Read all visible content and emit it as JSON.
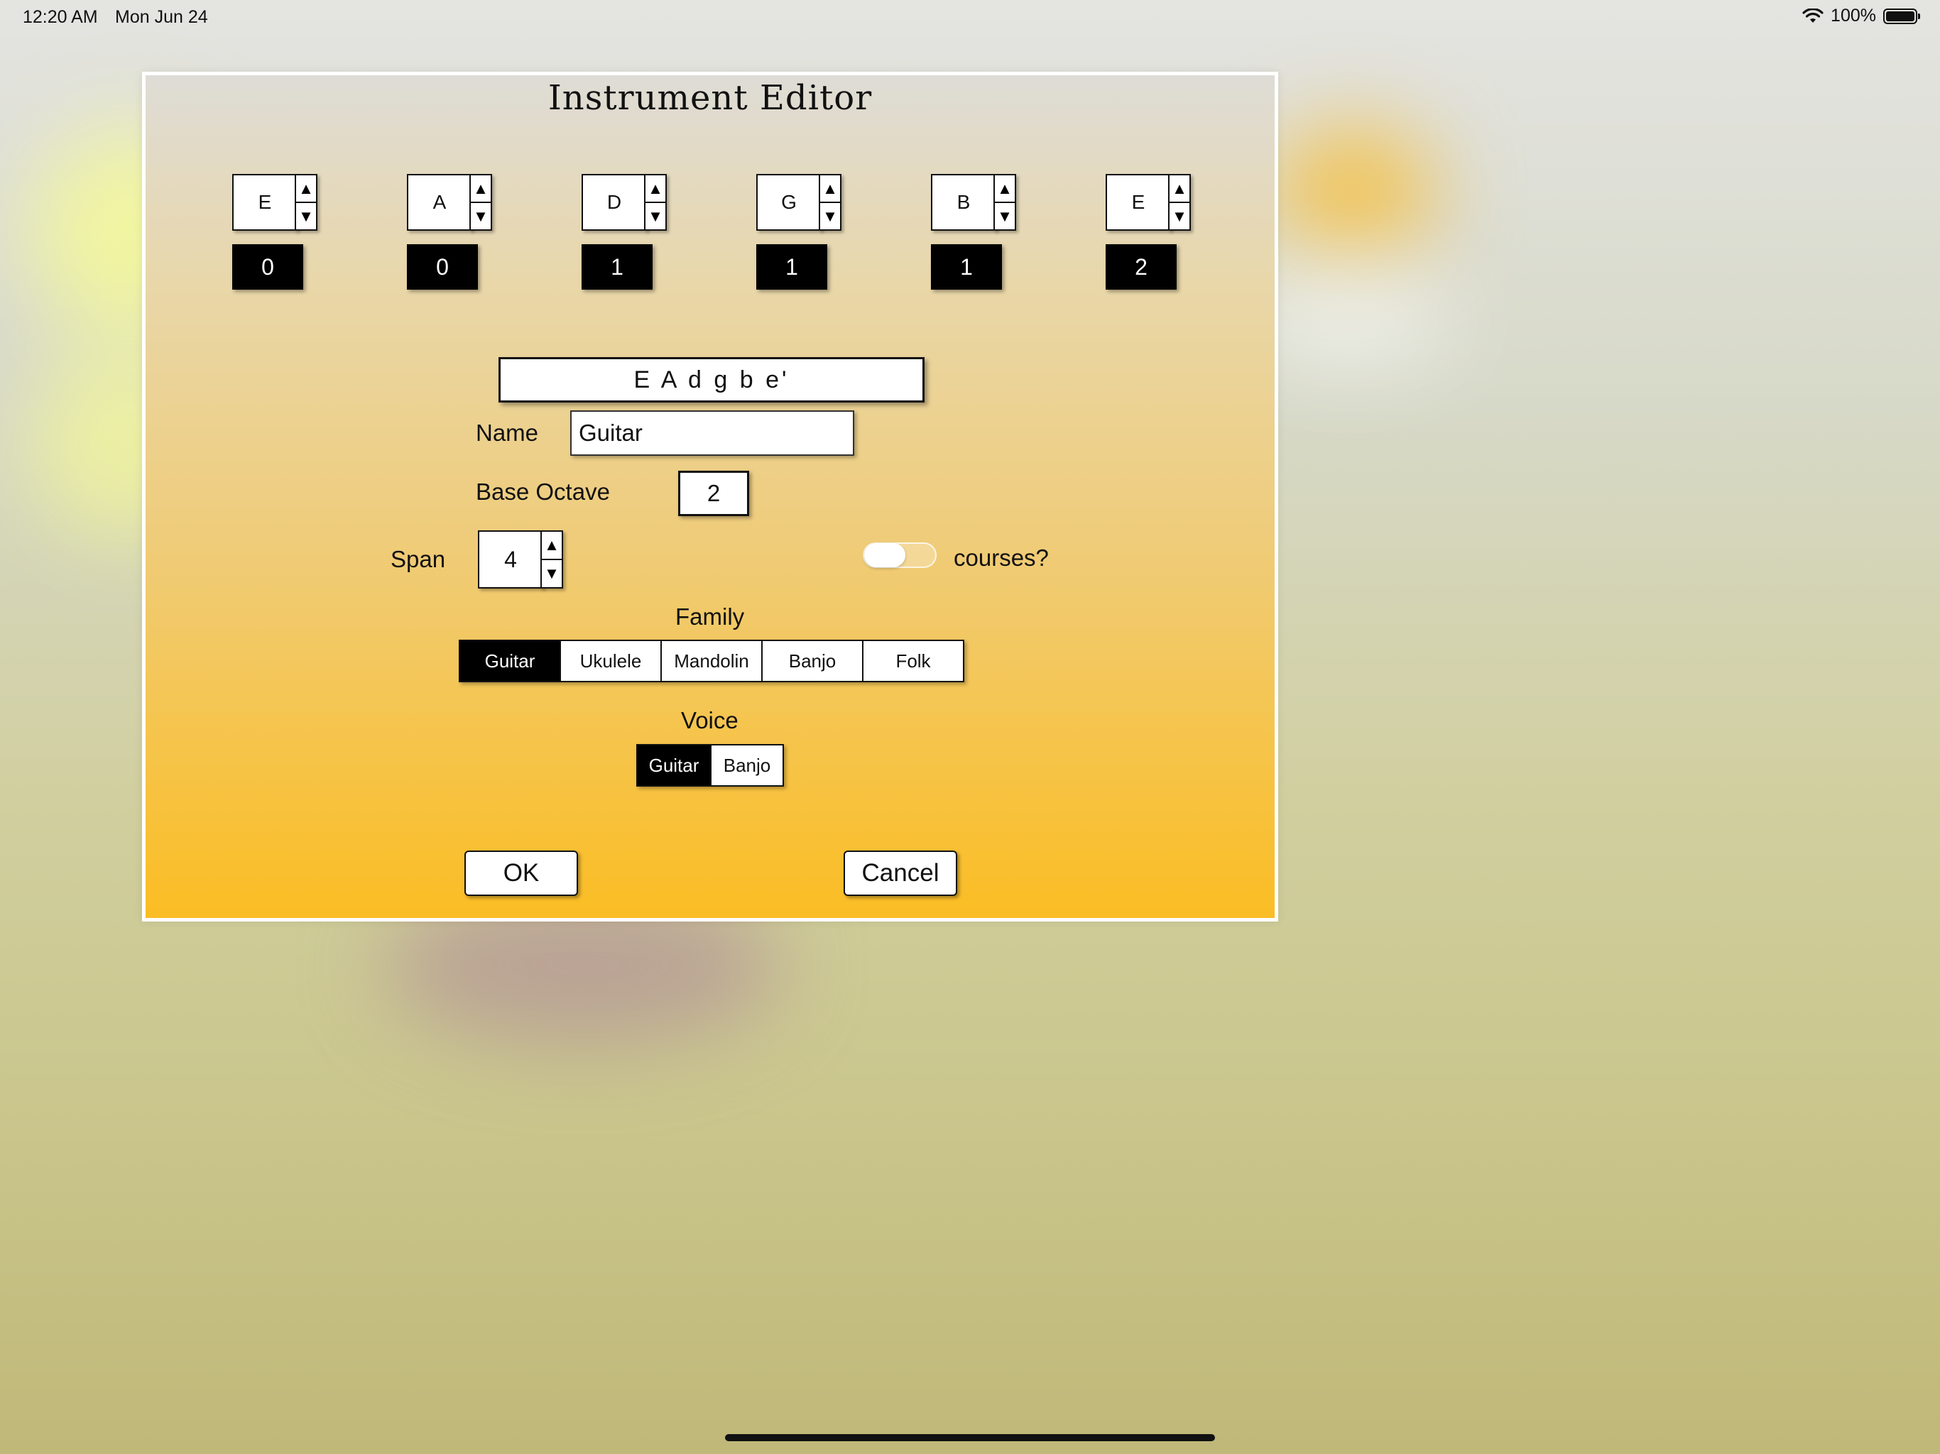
{
  "status_bar": {
    "time": "12:20 AM",
    "date": "Mon Jun 24",
    "battery": "100%"
  },
  "dialog": {
    "title": "Instrument Editor",
    "strings": [
      {
        "note": "E",
        "octave": "0"
      },
      {
        "note": "A",
        "octave": "0"
      },
      {
        "note": "D",
        "octave": "1"
      },
      {
        "note": "G",
        "octave": "1"
      },
      {
        "note": "B",
        "octave": "1"
      },
      {
        "note": "E",
        "octave": "2"
      }
    ],
    "stepper_up": "▲",
    "stepper_down": "▼",
    "tuning": "E A d g b e'",
    "name_label": "Name",
    "name_value": "Guitar",
    "base_octave_label": "Base Octave",
    "base_octave_value": "2",
    "span_label": "Span",
    "span_value": "4",
    "courses_label": "courses?",
    "courses_enabled": false,
    "family_label": "Family",
    "family_options": [
      "Guitar",
      "Ukulele",
      "Mandolin",
      "Banjo",
      "Folk"
    ],
    "family_selected": "Guitar",
    "voice_label": "Voice",
    "voice_options": [
      "Guitar",
      "Banjo"
    ],
    "voice_selected": "Guitar",
    "ok_label": "OK",
    "cancel_label": "Cancel"
  }
}
